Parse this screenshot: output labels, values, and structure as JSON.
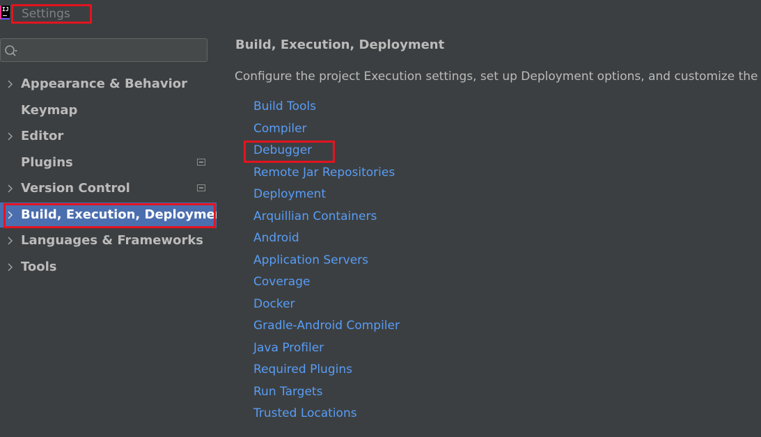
{
  "window": {
    "title": "Settings",
    "app_icon_text": "IJ"
  },
  "search": {
    "value": "",
    "placeholder": ""
  },
  "sidebar": {
    "items": [
      {
        "label": "Appearance & Behavior",
        "expandable": true
      },
      {
        "label": "Keymap",
        "expandable": false
      },
      {
        "label": "Editor",
        "expandable": true
      },
      {
        "label": "Plugins",
        "expandable": false
      },
      {
        "label": "Version Control",
        "expandable": true
      },
      {
        "label": "Build, Execution, Deployment",
        "expandable": true,
        "selected": true
      },
      {
        "label": "Languages & Frameworks",
        "expandable": true
      },
      {
        "label": "Tools",
        "expandable": true
      }
    ]
  },
  "main": {
    "heading": "Build, Execution, Deployment",
    "description": "Configure the project Execution settings, set up Deployment options, and customize the",
    "links": [
      "Build Tools",
      "Compiler",
      "Debugger",
      "Remote Jar Repositories",
      "Deployment",
      "Arquillian Containers",
      "Android",
      "Application Servers",
      "Coverage",
      "Docker",
      "Gradle-Android Compiler",
      "Java Profiler",
      "Required Plugins",
      "Run Targets",
      "Trusted Locations"
    ]
  },
  "colors": {
    "background": "#3c3f41",
    "selection": "#4b6eaf",
    "link": "#589df6",
    "text": "#bbbbbb",
    "highlight_box": "#e3141f"
  }
}
